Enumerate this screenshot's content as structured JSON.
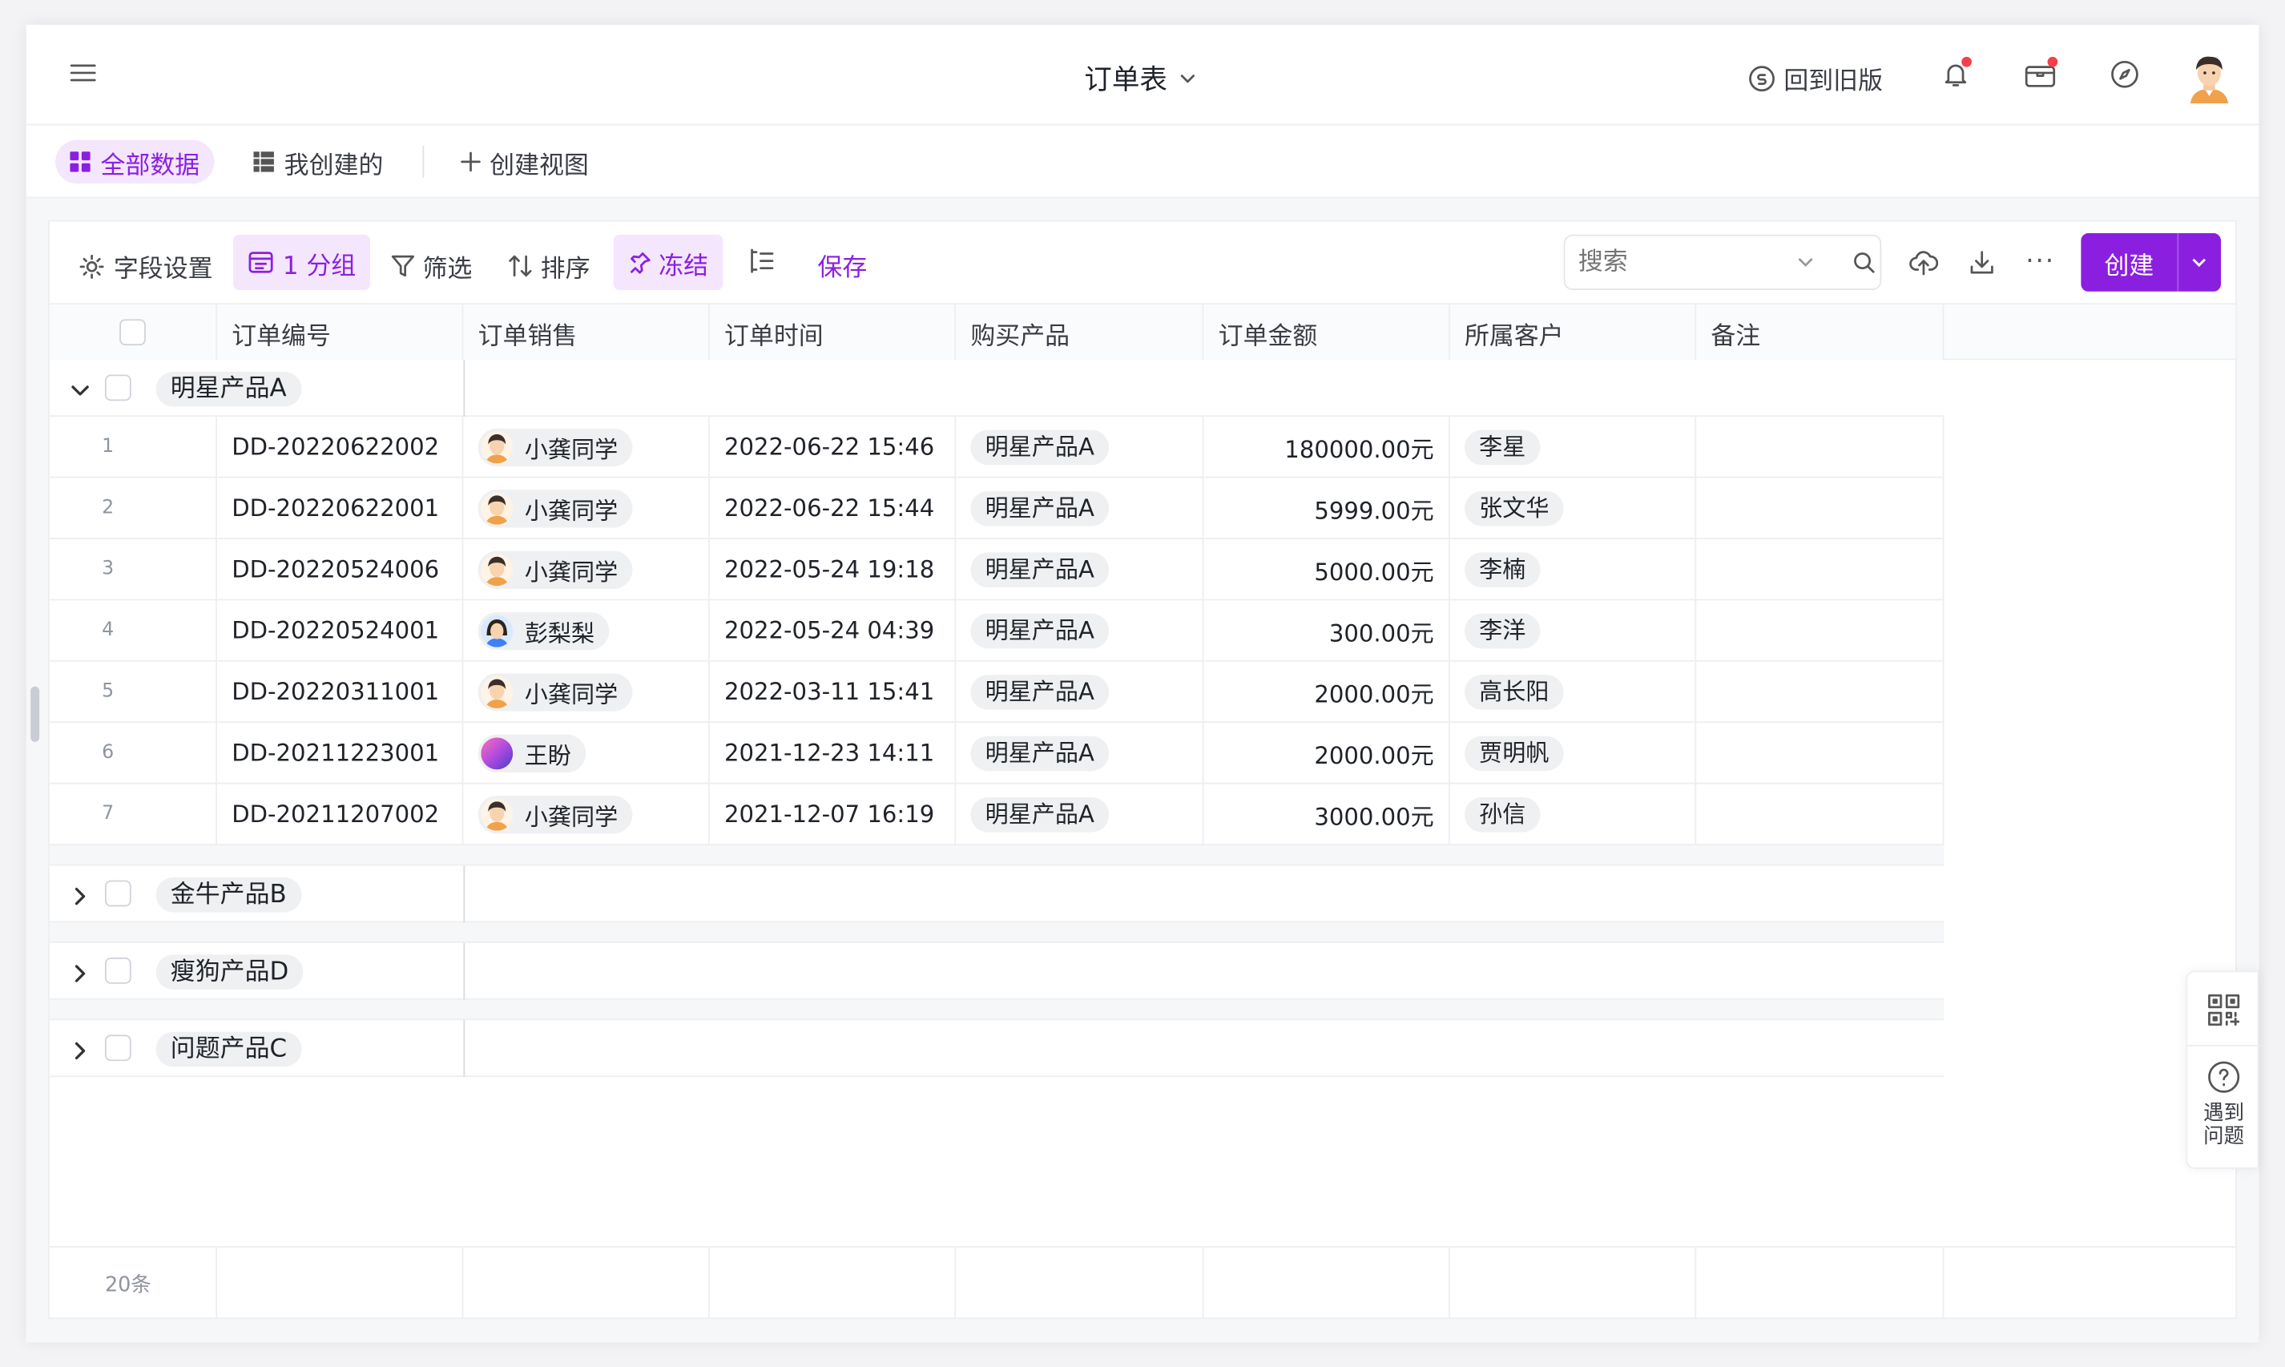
{
  "app": {
    "title": "订单表",
    "back_to_old": "回到旧版"
  },
  "views": {
    "all_data": "全部数据",
    "created_by_me": "我创建的",
    "create_view": "创建视图"
  },
  "toolbar": {
    "field_settings": "字段设置",
    "group": "1 分组",
    "filter": "筛选",
    "sort": "排序",
    "freeze": "冻结",
    "save": "保存",
    "search_placeholder": "搜索",
    "create": "创建"
  },
  "table": {
    "columns": [
      "订单编号",
      "订单销售",
      "订单时间",
      "购买产品",
      "订单金额",
      "所属客户",
      "备注"
    ],
    "groups": [
      {
        "name": "明星产品A",
        "expanded": true,
        "rows": [
          {
            "index": "1",
            "order_no": "DD-20220622002",
            "seller": "小龚同学",
            "avatar": "man",
            "time": "2022-06-22 15:46",
            "product": "明星产品A",
            "amount": "180000.00元",
            "customer": "李星",
            "note": ""
          },
          {
            "index": "2",
            "order_no": "DD-20220622001",
            "seller": "小龚同学",
            "avatar": "man",
            "time": "2022-06-22 15:44",
            "product": "明星产品A",
            "amount": "5999.00元",
            "customer": "张文华",
            "note": ""
          },
          {
            "index": "3",
            "order_no": "DD-20220524006",
            "seller": "小龚同学",
            "avatar": "man",
            "time": "2022-05-24 19:18",
            "product": "明星产品A",
            "amount": "5000.00元",
            "customer": "李楠",
            "note": ""
          },
          {
            "index": "4",
            "order_no": "DD-20220524001",
            "seller": "彭梨梨",
            "avatar": "woman",
            "time": "2022-05-24 04:39",
            "product": "明星产品A",
            "amount": "300.00元",
            "customer": "李洋",
            "note": ""
          },
          {
            "index": "5",
            "order_no": "DD-20220311001",
            "seller": "小龚同学",
            "avatar": "man",
            "time": "2022-03-11 15:41",
            "product": "明星产品A",
            "amount": "2000.00元",
            "customer": "高长阳",
            "note": ""
          },
          {
            "index": "6",
            "order_no": "DD-20211223001",
            "seller": "王盼",
            "avatar": "gradient",
            "time": "2021-12-23 14:11",
            "product": "明星产品A",
            "amount": "2000.00元",
            "customer": "贾明帆",
            "note": ""
          },
          {
            "index": "7",
            "order_no": "DD-20211207002",
            "seller": "小龚同学",
            "avatar": "man",
            "time": "2021-12-07 16:19",
            "product": "明星产品A",
            "amount": "3000.00元",
            "customer": "孙信",
            "note": ""
          }
        ]
      },
      {
        "name": "金牛产品B",
        "expanded": false,
        "rows": []
      },
      {
        "name": "瘦狗产品D",
        "expanded": false,
        "rows": []
      },
      {
        "name": "问题产品C",
        "expanded": false,
        "rows": []
      }
    ],
    "footer_count": "20条"
  },
  "help": {
    "label": "遇到问题"
  },
  "colors": {
    "accent": "#8b1fe0",
    "accent_light": "#f3e6fd",
    "badge_red": "#f5404a"
  }
}
